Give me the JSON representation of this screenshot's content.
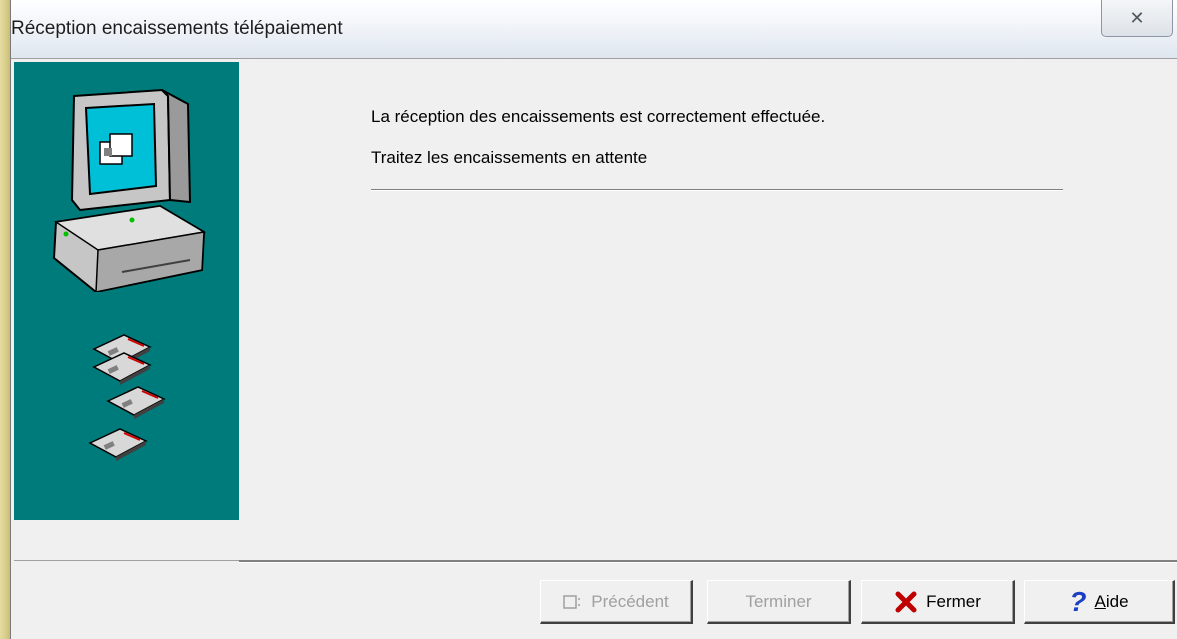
{
  "window": {
    "title": "Réception encaissements télépaiement",
    "close_label": "✕"
  },
  "content": {
    "message_line1": "La réception des encaissements est correctement effectuée.",
    "message_line2": "Traitez les encaissements en attente"
  },
  "buttons": {
    "previous": {
      "label": "Précédent",
      "enabled": false
    },
    "finish": {
      "label": "Terminer",
      "enabled": false
    },
    "close": {
      "label": "Fermer",
      "enabled": true
    },
    "help": {
      "label_first": "A",
      "label_rest": "ide",
      "enabled": true
    }
  },
  "icons": {
    "computer": "computer-icon",
    "disks": "floppy-disk-icon",
    "close_x": "red-x-icon",
    "help": "question-mark-icon"
  },
  "colors": {
    "side_panel": "#007b7b",
    "close_x": "#c00000",
    "help": "#1a3fc4"
  }
}
